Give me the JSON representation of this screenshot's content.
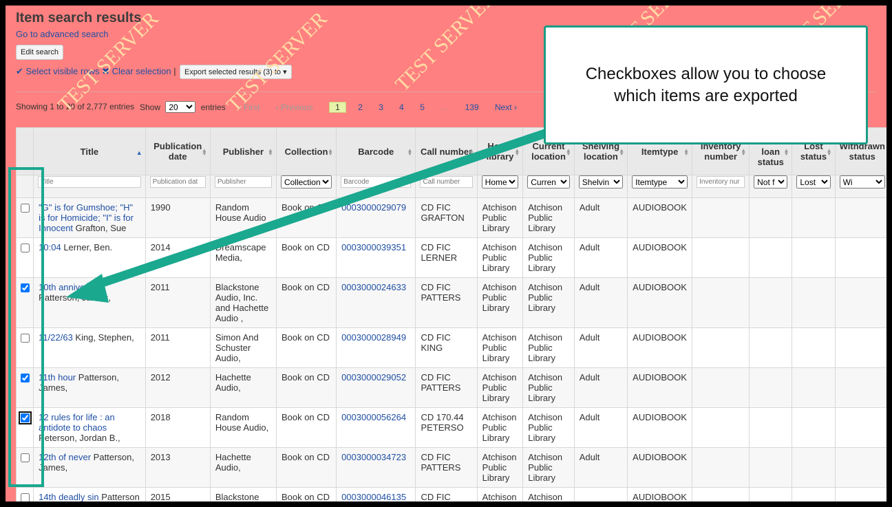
{
  "page": {
    "title": "Item search results",
    "advanced_link": "Go to advanced search",
    "edit_search": "Edit search",
    "select_visible": "Select visible rows",
    "clear_selection": "Clear selection",
    "separator": "|",
    "export_button": "Export selected results (3) to",
    "watermark": "TEST SERVER"
  },
  "colors": {
    "background": "#ff8080",
    "link": "#1f4fa3",
    "callout_border": "#1a9c85",
    "watermark": "#ffe0a8"
  },
  "icons": {
    "select": "check-icon",
    "clear": "x-icon",
    "dropdown": "caret-down-icon",
    "sort": "sort-icon"
  },
  "info": {
    "showing": "Showing 1 to 20 of 2,777 entries",
    "show_label": "Show",
    "page_size": "20",
    "entries_label": "entries"
  },
  "pager": {
    "first": "« First",
    "previous": "‹ Previous",
    "pages": [
      "1",
      "2",
      "3",
      "4",
      "5"
    ],
    "ellipsis": "…",
    "last_page": "139",
    "next": "Next ›",
    "current": "1"
  },
  "callout": {
    "line1": "Checkboxes allow you to choose",
    "line2": "which items are exported"
  },
  "table": {
    "headers": [
      "",
      "Title",
      "Publication date",
      "Publisher",
      "Collection",
      "Barcode",
      "Call number",
      "Home library",
      "Current location",
      "Shelving location",
      "Itemtype",
      "Inventory number",
      "Not for loan status",
      "Lost status",
      "Withdrawn status"
    ],
    "filters": {
      "title": "Title",
      "pubdate": "Publication dat",
      "publisher": "Publisher",
      "collection": "Collection",
      "barcode": "Barcode",
      "callnumber": "Call number",
      "home": "Home",
      "current": "Curren",
      "shelving": "Shelvin",
      "itemtype": "Itemtype",
      "inventory": "Inventory nur",
      "notforloan": "Not f",
      "lost": "Lost",
      "withdrawn": "Wi"
    },
    "rows": [
      {
        "checked": false,
        "title": "\"G\" is for Gumshoe; \"H\" is for Homicide; \"I\" is for Innocent",
        "author": "Grafton, Sue",
        "pubdate": "1990",
        "publisher": "Random House Audio",
        "collection": "Book on CD",
        "barcode": "0003000029079",
        "callnumber": "CD FIC GRAFTON",
        "home": "Atchison Public Library",
        "current": "Atchison Public Library",
        "shelving": "Adult",
        "itemtype": "AUDIOBOOK"
      },
      {
        "checked": false,
        "title": "10:04",
        "author": "Lerner, Ben.",
        "pubdate": "2014",
        "publisher": "Dreamscape Media,",
        "collection": "Book on CD",
        "barcode": "0003000039351",
        "callnumber": "CD FIC LERNER",
        "home": "Atchison Public Library",
        "current": "Atchison Public Library",
        "shelving": "Adult",
        "itemtype": "AUDIOBOOK"
      },
      {
        "checked": true,
        "title": "10th anniversary",
        "author": "Patterson, James,",
        "pubdate": "2011",
        "publisher": "Blackstone Audio, Inc. and Hachette Audio ,",
        "collection": "Book on CD",
        "barcode": "0003000024633",
        "callnumber": "CD FIC PATTERS",
        "home": "Atchison Public Library",
        "current": "Atchison Public Library",
        "shelving": "Adult",
        "itemtype": "AUDIOBOOK"
      },
      {
        "checked": false,
        "title": "11/22/63",
        "author": "King, Stephen,",
        "pubdate": "2011",
        "publisher": "Simon And Schuster Audio,",
        "collection": "Book on CD",
        "barcode": "0003000028949",
        "callnumber": "CD FIC KING",
        "home": "Atchison Public Library",
        "current": "Atchison Public Library",
        "shelving": "Adult",
        "itemtype": "AUDIOBOOK"
      },
      {
        "checked": true,
        "title": "11th hour",
        "author": "Patterson, James,",
        "pubdate": "2012",
        "publisher": "Hachette Audio,",
        "collection": "Book on CD",
        "barcode": "0003000029052",
        "callnumber": "CD FIC PATTERS",
        "home": "Atchison Public Library",
        "current": "Atchison Public Library",
        "shelving": "Adult",
        "itemtype": "AUDIOBOOK"
      },
      {
        "checked": true,
        "title": "12 rules for life : an antidote to chaos",
        "author": "Peterson, Jordan B.,",
        "pubdate": "2018",
        "publisher": "Random House Audio,",
        "collection": "Book on CD",
        "barcode": "0003000056264",
        "callnumber": "CD 170.44 PETERSO",
        "home": "Atchison Public Library",
        "current": "Atchison Public Library",
        "shelving": "Adult",
        "itemtype": "AUDIOBOOK"
      },
      {
        "checked": false,
        "title": "12th of never",
        "author": "Patterson, James,",
        "pubdate": "2013",
        "publisher": "Hachette Audio,",
        "collection": "Book on CD",
        "barcode": "0003000034723",
        "callnumber": "CD FIC PATTERS",
        "home": "Atchison Public Library",
        "current": "Atchison Public Library",
        "shelving": "Adult",
        "itemtype": "AUDIOBOOK"
      },
      {
        "checked": false,
        "title": "14th deadly sin",
        "author": "Patterson",
        "pubdate": "2015",
        "publisher": "Blackstone",
        "collection": "Book on CD",
        "barcode": "0003000046135",
        "callnumber": "CD FIC",
        "home": "Atchison",
        "current": "Atchison",
        "shelving": "",
        "itemtype": "AUDIOBOOK"
      }
    ]
  }
}
